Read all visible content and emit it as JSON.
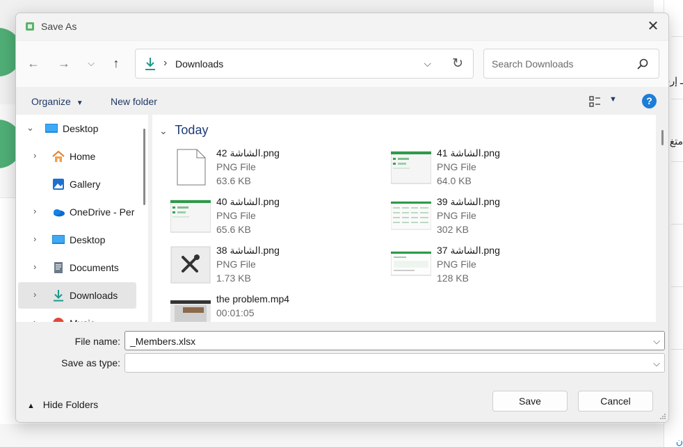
{
  "background": {
    "rtl_text_1": "ـ إرسا",
    "rtl_text_2": "متغ",
    "rtl_text_3": "ن"
  },
  "dialog": {
    "title": "Save As",
    "close_glyph": "✕"
  },
  "nav": {
    "back_glyph": "←",
    "forward_glyph": "→",
    "recent_glyph": "⌵",
    "up_glyph": "↑",
    "address_path": "Downloads",
    "address_chevron": "›",
    "search_placeholder": "Search Downloads"
  },
  "toolbar": {
    "organize_label": "Organize",
    "organize_caret": "▼",
    "new_folder_label": "New folder",
    "view_caret": "▼",
    "help_glyph": "?"
  },
  "navpane": {
    "items": [
      {
        "label": "Desktop",
        "arrow": "⌄",
        "icon": "desktop-icon",
        "level": 0
      },
      {
        "label": "Home",
        "arrow": "›",
        "icon": "home-icon",
        "level": 1
      },
      {
        "label": "Gallery",
        "arrow": "",
        "icon": "gallery-icon",
        "level": 1
      },
      {
        "label": "OneDrive - Per",
        "arrow": "›",
        "icon": "onedrive-icon",
        "level": 1
      },
      {
        "label": "Desktop",
        "arrow": "›",
        "icon": "desktop-icon",
        "level": 1
      },
      {
        "label": "Documents",
        "arrow": "›",
        "icon": "documents-icon",
        "level": 1
      },
      {
        "label": "Downloads",
        "arrow": "›",
        "icon": "downloads-icon",
        "level": 1,
        "selected": true
      },
      {
        "label": "Music",
        "arrow": "›",
        "icon": "music-icon",
        "level": 1
      }
    ]
  },
  "content": {
    "group_label": "Today",
    "group_chevron": "⌄",
    "files": [
      {
        "name": "الشاشة 42.png",
        "type": "PNG File",
        "size": "63.6 KB",
        "thumb": "blank"
      },
      {
        "name": "الشاشة 41.png",
        "type": "PNG File",
        "size": "64.0 KB",
        "thumb": "screen-a"
      },
      {
        "name": "الشاشة 40.png",
        "type": "PNG File",
        "size": "65.6 KB",
        "thumb": "screen-a"
      },
      {
        "name": "الشاشة 39.png",
        "type": "PNG File",
        "size": "302 KB",
        "thumb": "screen-b"
      },
      {
        "name": "الشاشة 38.png",
        "type": "PNG File",
        "size": "1.73 KB",
        "thumb": "tools"
      },
      {
        "name": "الشاشة 37.png",
        "type": "PNG File",
        "size": "128 KB",
        "thumb": "screen-c"
      },
      {
        "name": "the problem.mp4",
        "type": "00:01:05",
        "size": "",
        "thumb": "video"
      }
    ]
  },
  "form": {
    "file_name_label": "File name:",
    "file_name_value": "_Members.xlsx",
    "save_type_label": "Save as type:",
    "save_type_value": "",
    "drop_glyph": "⌵"
  },
  "footer": {
    "hide_folders_label": "Hide Folders",
    "hide_folders_caret": "▲",
    "save_label": "Save",
    "cancel_label": "Cancel"
  }
}
